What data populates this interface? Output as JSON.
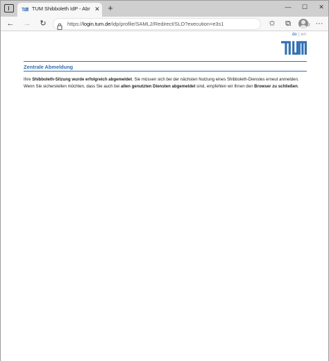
{
  "browser": {
    "tab": {
      "title": "TUM Shibboleth IdP - Abmeldung",
      "close_glyph": "✕"
    },
    "new_tab_glyph": "+",
    "window_controls": {
      "minimize": "—",
      "maximize": "☐",
      "close": "✕"
    },
    "toolbar": {
      "back_glyph": "←",
      "forward_glyph": "→",
      "reload_glyph": "↻",
      "url_scheme": "https://",
      "url_host": "login.tum.de",
      "url_path": "/idp/profile/SAML2/Redirect/SLO?execution=e3s1",
      "add_favorite_glyph": "☆",
      "favorites_glyph": "✩",
      "collections_glyph": "⧉",
      "menu_glyph": "···"
    }
  },
  "page": {
    "language": {
      "de": "de",
      "separator": "|",
      "en": "en"
    },
    "logo_color": "#3070b3",
    "heading": "Zentrale Abmeldung",
    "message": {
      "p1": "Ihre ",
      "b1": "Shibboleth-Sitzung wurde erfolgreich abgemeldet",
      "p2": ". Sie müssen sich bei der nächsten Nutzung eines Shibboleth-Dienstes erneut anmelden. Wenn Sie sicherstellen möchten, dass Sie auch bei ",
      "b2": "allen genutzten Diensten abgemeldet",
      "p3": " sind, empfehlen wir Ihnen den ",
      "b3": "Browser zu schließen",
      "p4": "."
    }
  }
}
